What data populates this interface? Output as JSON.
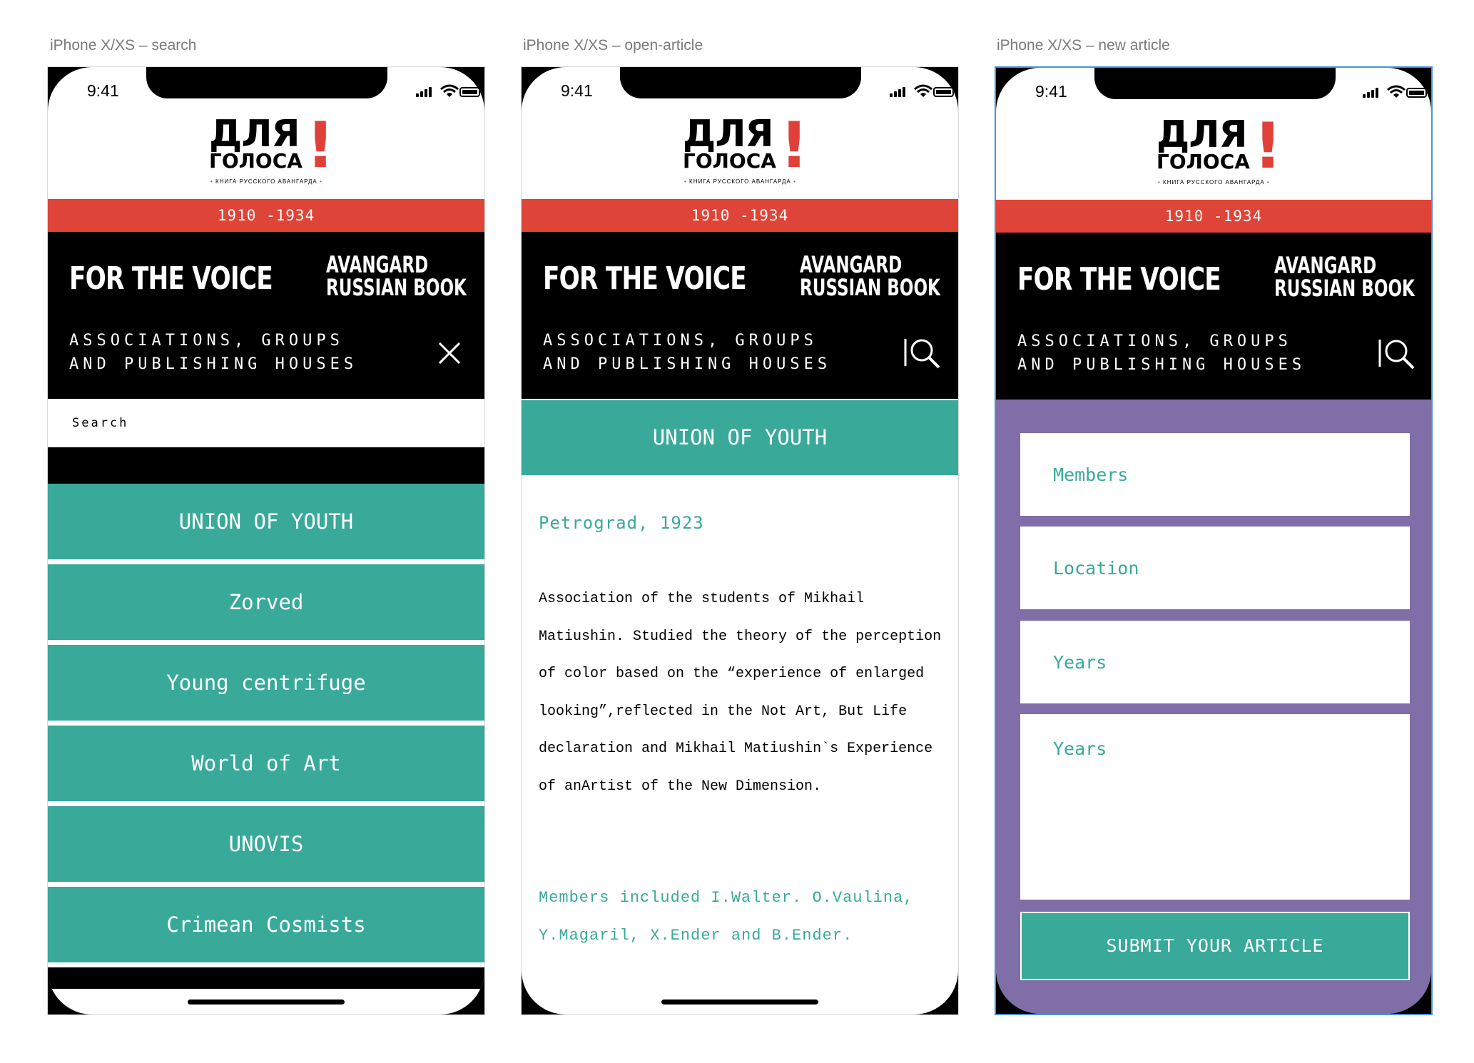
{
  "artboards": [
    {
      "title": "iPhone X/XS – search"
    },
    {
      "title": "iPhone X/XS – open-article"
    },
    {
      "title": "iPhone X/XS – new article"
    }
  ],
  "status_time": "9:41",
  "logo": {
    "main": "ДЛЯ",
    "sub": "ГОЛОСА",
    "bang": "!",
    "tagline": "КНИГА РУССКОГО АВАНГАРДА"
  },
  "years": "1910 -1934",
  "header": {
    "title": "FOR THE VOICE",
    "right_line1": "AVANGARD",
    "right_line2": "RUSSIAN BOOK",
    "subtitle": "ASSOCIATIONS, GROUPS AND PUBLISHING HOUSES"
  },
  "search": {
    "placeholder": "Search",
    "results": [
      "UNION OF YOUTH",
      "Zorved",
      "Young centrifuge",
      "World of Art",
      "UNOVIS",
      "Crimean Cosmists"
    ]
  },
  "article": {
    "title": "UNION OF YOUTH",
    "location_date": "Petrograd, 1923",
    "body": "Association of the students of Mikhail Matiushin. Studied the theory of the perception of color based on the “experience of enlarged looking”,reflected in the Not  Art, But Life declaration and Mikhail Matiushin`s Experience of anArtist of the New Dimension.",
    "members": "Members included I.Walter. O.Vaulina, Y.Magaril, X.Ender and B.Ender."
  },
  "form": {
    "members_placeholder": "Members",
    "location_placeholder": "Location",
    "years_placeholder": "Years",
    "years2_placeholder": "Years",
    "submit_label": "SUBMIT YOUR ARTICLE"
  },
  "colors": {
    "accent_red": "#df4438",
    "teal": "#39a999",
    "purple": "#7f6ea7",
    "selection": "#4a90e2"
  }
}
